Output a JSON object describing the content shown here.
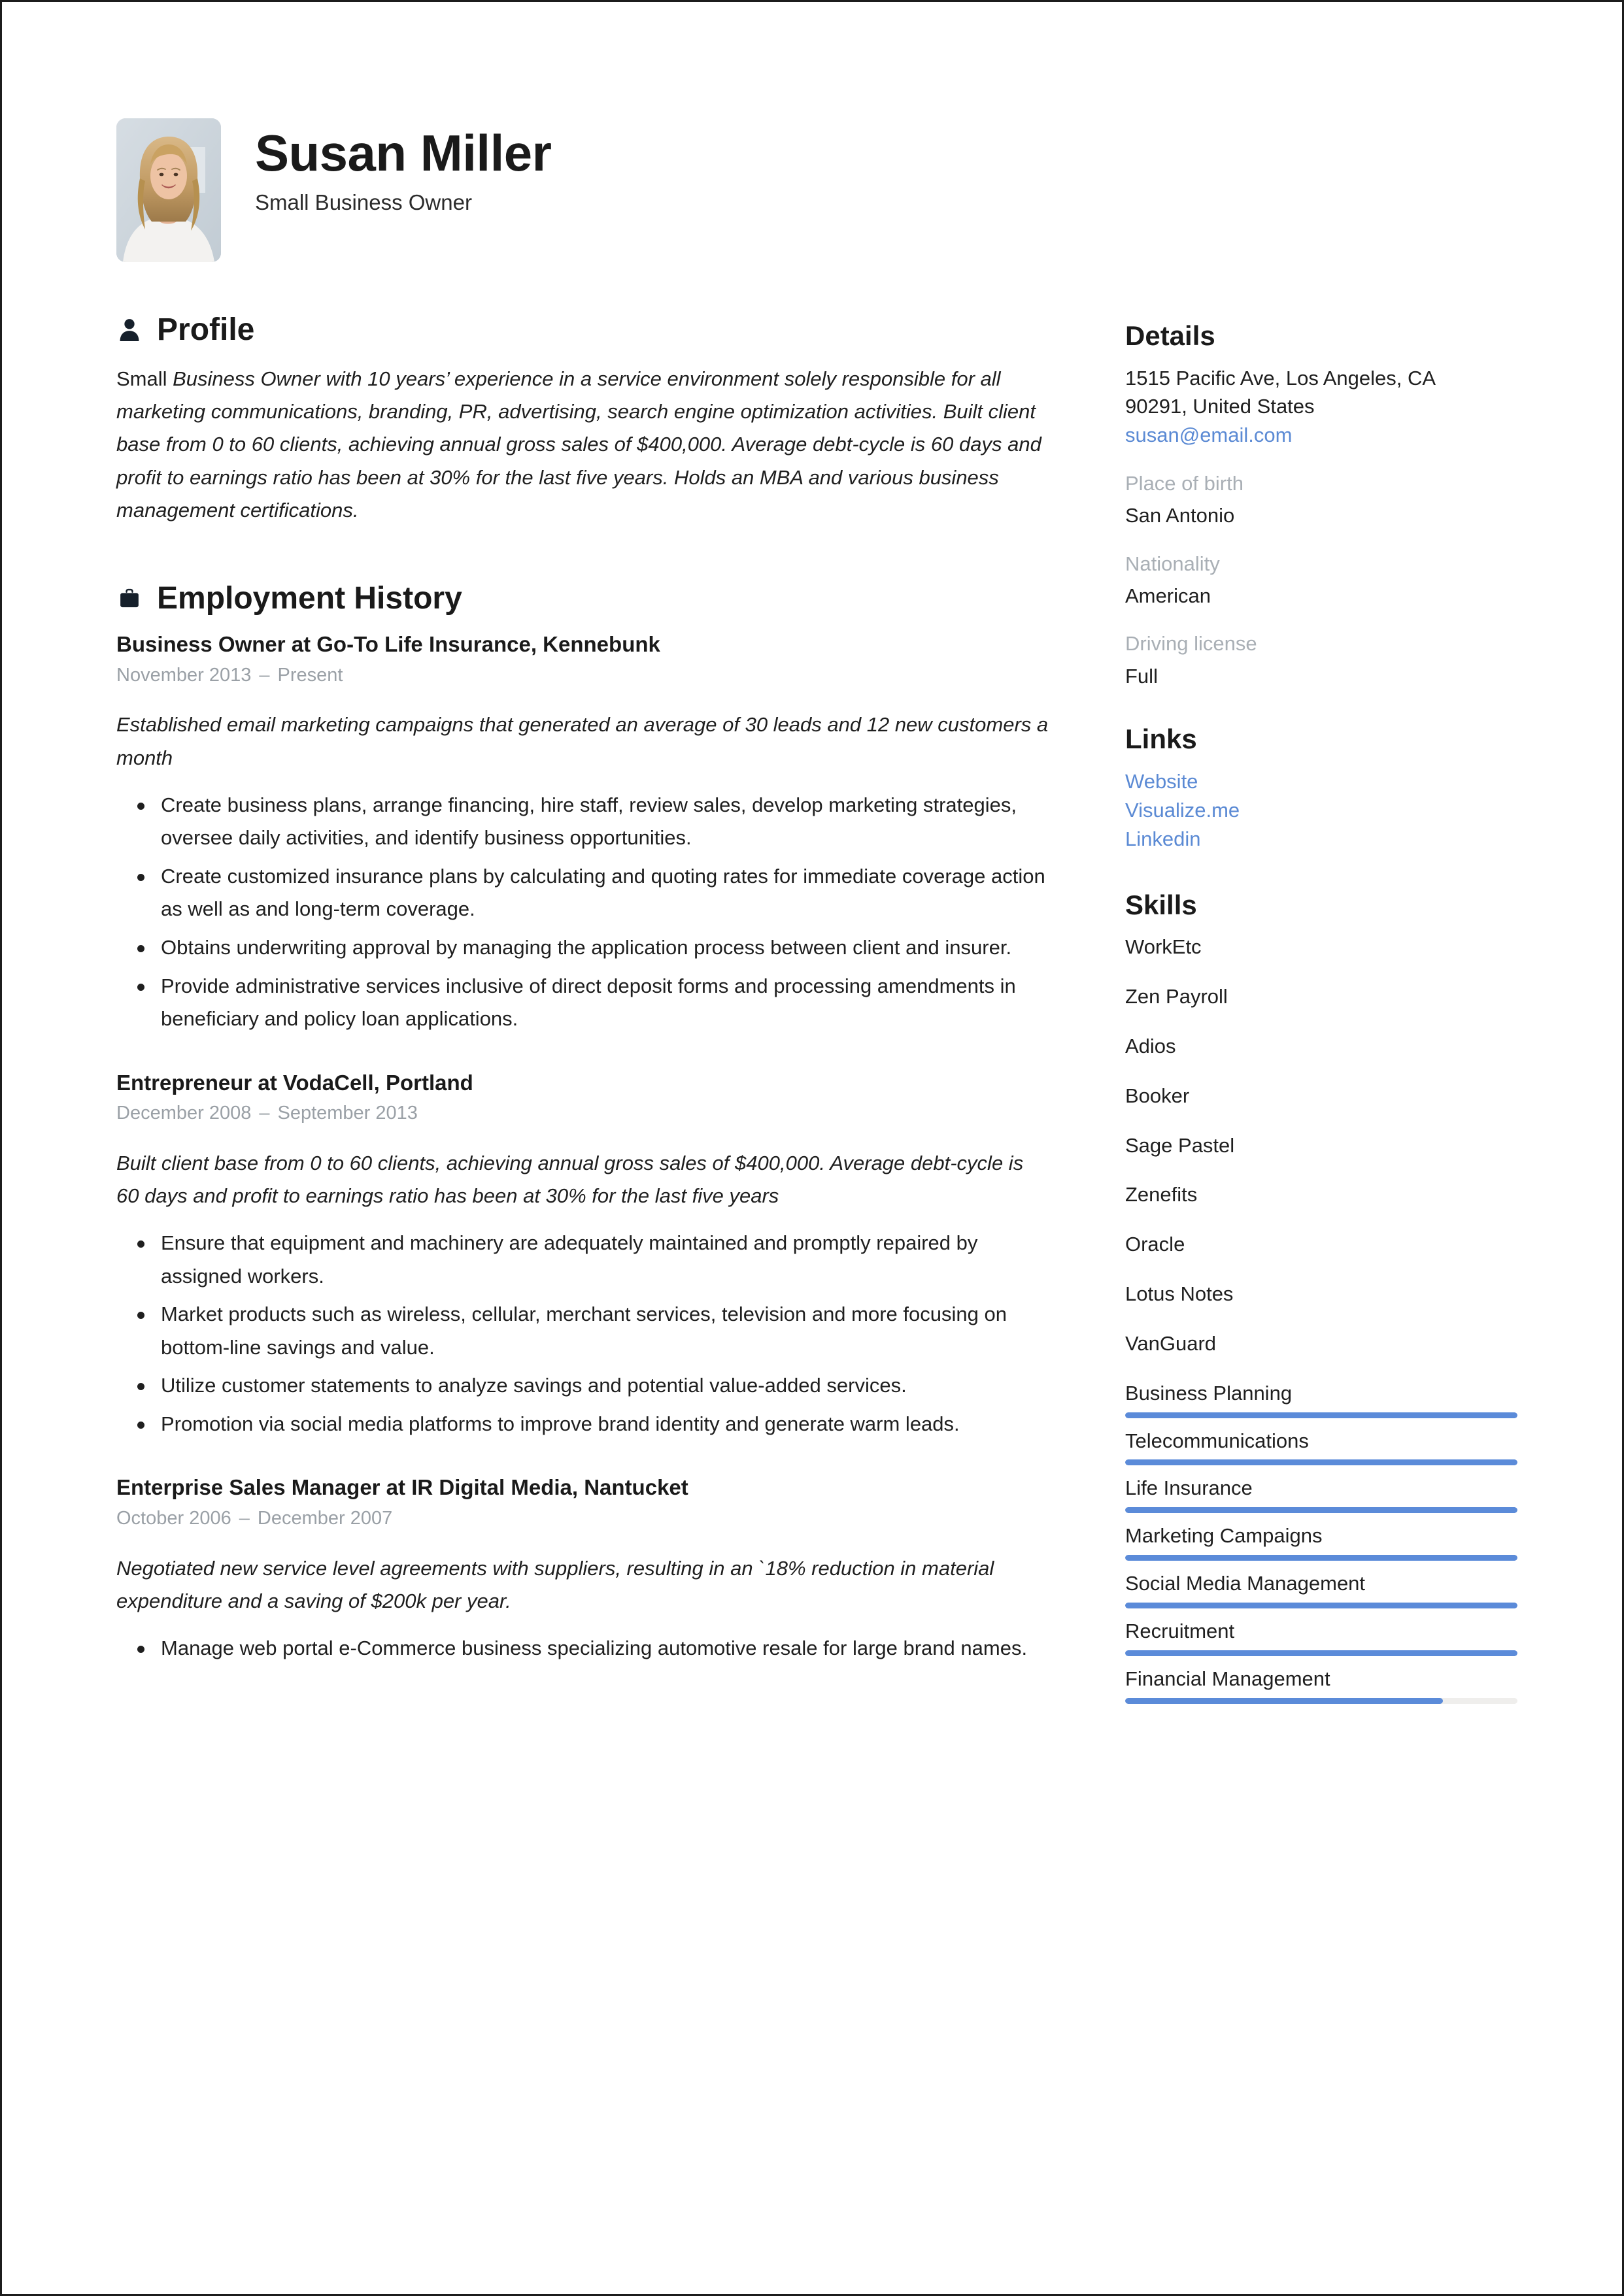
{
  "header": {
    "name": "Susan Miller",
    "job_title": "Small Business Owner",
    "avatar_alt": "portrait-photo"
  },
  "profile": {
    "section_title": "Profile",
    "icon": "person-icon",
    "lead_word": "Small",
    "body": " Business Owner with 10 years’ experience in a service environment solely responsible for all marketing communications, branding, PR, advertising, search engine optimization activities. Built client base from 0 to 60 clients, achieving annual gross sales of $400,000. Average debt-cycle is 60 days and profit to earnings ratio has been at 30% for the last five years. Holds an MBA and various business management certifications."
  },
  "employment": {
    "section_title": "Employment History",
    "icon": "briefcase-icon",
    "jobs": [
      {
        "heading": "Business Owner at Go-To Life Insurance, Kennebunk",
        "start": "November 2013",
        "separator": "–",
        "end": "Present",
        "summary": "Established email marketing campaigns that generated an average of 30 leads and 12 new customers a month",
        "bullets": [
          "Create business plans, arrange financing, hire staff, review sales, develop marketing strategies, oversee daily activities, and identify business opportunities.",
          "Create customized insurance plans by calculating and quoting rates for immediate coverage action as well as and long-term coverage.",
          "Obtains underwriting approval by managing the application process between client and insurer.",
          "Provide administrative services inclusive of direct deposit forms and processing amendments in beneficiary and policy loan applications."
        ]
      },
      {
        "heading": "Entrepreneur at VodaCell, Portland",
        "start": "December 2008",
        "separator": "–",
        "end": "September 2013",
        "summary": "Built client base from 0 to 60 clients, achieving annual gross sales of $400,000. Average debt-cycle is 60 days and profit to earnings ratio has been at 30% for the last five years",
        "bullets": [
          "Ensure that equipment and machinery are adequately maintained and promptly repaired by assigned workers.",
          "Market products such as wireless, cellular, merchant services, television and more focusing on bottom-line savings and value.",
          "Utilize customer statements to analyze savings and potential value-added services.",
          "Promotion via social media platforms to improve brand identity and generate warm leads."
        ]
      },
      {
        "heading": "Enterprise Sales Manager at IR Digital Media, Nantucket",
        "start": "October 2006",
        "separator": "–",
        "end": "December 2007",
        "summary": "Negotiated new service level agreements with suppliers, resulting in an `18% reduction in material expenditure and a saving of $200k per year.",
        "bullets": [
          "Manage web portal e-Commerce business specializing automotive resale for large brand names."
        ]
      }
    ]
  },
  "details": {
    "section_title": "Details",
    "address_line1": "1515 Pacific Ave, Los Angeles, CA",
    "address_line2": "90291, United States",
    "email": "susan@email.com",
    "fields": [
      {
        "label": "Place of birth",
        "value": "San Antonio"
      },
      {
        "label": "Nationality",
        "value": "American"
      },
      {
        "label": "Driving license",
        "value": "Full"
      }
    ]
  },
  "links": {
    "section_title": "Links",
    "items": [
      "Website",
      "Visualize.me",
      "Linkedin"
    ]
  },
  "skills": {
    "section_title": "Skills",
    "items": [
      {
        "name": "WorkEtc",
        "level": null
      },
      {
        "name": "Zen Payroll",
        "level": null
      },
      {
        "name": "Adios",
        "level": null
      },
      {
        "name": "Booker",
        "level": null
      },
      {
        "name": "Sage Pastel",
        "level": null
      },
      {
        "name": "Zenefits",
        "level": null
      },
      {
        "name": "Oracle",
        "level": null
      },
      {
        "name": "Lotus Notes",
        "level": null
      },
      {
        "name": "VanGuard",
        "level": null
      },
      {
        "name": "Business Planning",
        "level": 100
      },
      {
        "name": "Telecommunications",
        "level": 100
      },
      {
        "name": "Life Insurance",
        "level": 100
      },
      {
        "name": "Marketing Campaigns",
        "level": 100
      },
      {
        "name": "Social Media Management",
        "level": 100
      },
      {
        "name": "Recruitment",
        "level": 100
      },
      {
        "name": "Financial Management",
        "level": 81
      }
    ]
  },
  "colors": {
    "accent_blue": "#5b8bd9",
    "link_blue": "#5b8ad4",
    "muted_gray": "#a9afb5",
    "date_gray": "#9aa0a6",
    "text_dark": "#1a1a1a",
    "bar_track": "#efeeec"
  }
}
